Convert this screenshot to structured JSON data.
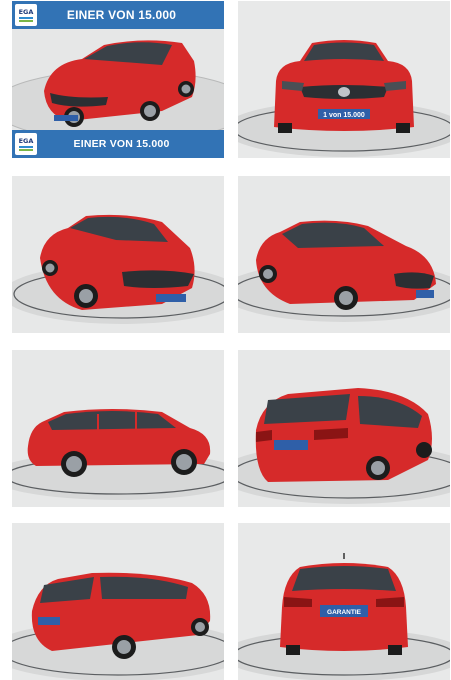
{
  "banner": {
    "top_text": "EINER VON 15.000",
    "bottom_text": "EINER VON 15.000",
    "logo_text": "EGA"
  },
  "plates": {
    "front": "1 von 15.000",
    "rear": "GARANTIE"
  },
  "colors": {
    "banner_blue": "#3273b5",
    "car_red": "#d62a2a",
    "studio_gray": "#e9eaea"
  },
  "photos": [
    {
      "view": "front-three-quarter-left"
    },
    {
      "view": "front"
    },
    {
      "view": "front-three-quarter-left-close"
    },
    {
      "view": "front-three-quarter-right"
    },
    {
      "view": "side-left"
    },
    {
      "view": "rear-three-quarter-left"
    },
    {
      "view": "rear-three-quarter-left-wide"
    },
    {
      "view": "rear"
    }
  ]
}
